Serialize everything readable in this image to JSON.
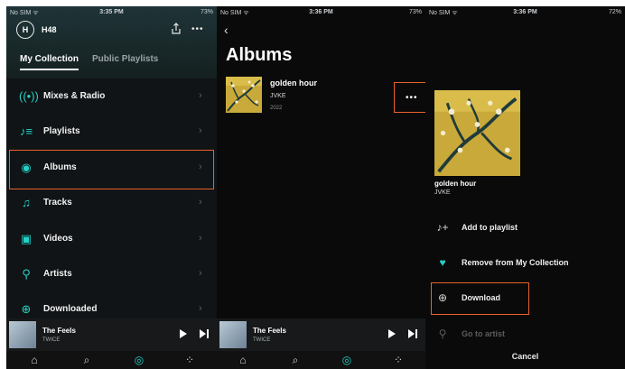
{
  "panel1": {
    "status": {
      "carrier": "No SIM ᯤ",
      "time": "3:35 PM",
      "battery": "73%"
    },
    "user": {
      "initial": "H",
      "name": "H48"
    },
    "tabs": {
      "active": "My Collection",
      "inactive": "Public Playlists"
    },
    "menu": [
      {
        "label": "Mixes & Radio",
        "icon": "radio-icon"
      },
      {
        "label": "Playlists",
        "icon": "playlist-icon"
      },
      {
        "label": "Albums",
        "icon": "album-icon"
      },
      {
        "label": "Tracks",
        "icon": "music-note-icon"
      },
      {
        "label": "Videos",
        "icon": "video-icon"
      },
      {
        "label": "Artists",
        "icon": "microphone-icon"
      },
      {
        "label": "Downloaded",
        "icon": "download-icon"
      }
    ]
  },
  "panel2": {
    "status": {
      "carrier": "No SIM ᯤ",
      "time": "3:36 PM",
      "battery": "73%"
    },
    "title": "Albums",
    "album": {
      "title": "golden hour",
      "artist": "JVKE",
      "year": "2022"
    }
  },
  "panel3": {
    "status": {
      "carrier": "No SIM ᯤ",
      "time": "3:36 PM",
      "battery": "72%"
    },
    "album": {
      "title": "golden hour",
      "artist": "JVKE"
    },
    "actions": [
      {
        "label": "Add to playlist",
        "icon": "add-to-playlist-icon"
      },
      {
        "label": "Remove from My Collection",
        "icon": "heart-icon"
      },
      {
        "label": "Download",
        "icon": "download-icon"
      },
      {
        "label": "Go to artist",
        "icon": "microphone-icon"
      }
    ],
    "cancel": "Cancel"
  },
  "miniplayer": {
    "title": "The Feels",
    "artist": "TWICE"
  },
  "colors": {
    "accent": "#25d0c6",
    "highlight": "#e8622b",
    "background": "#0a0a0a"
  }
}
